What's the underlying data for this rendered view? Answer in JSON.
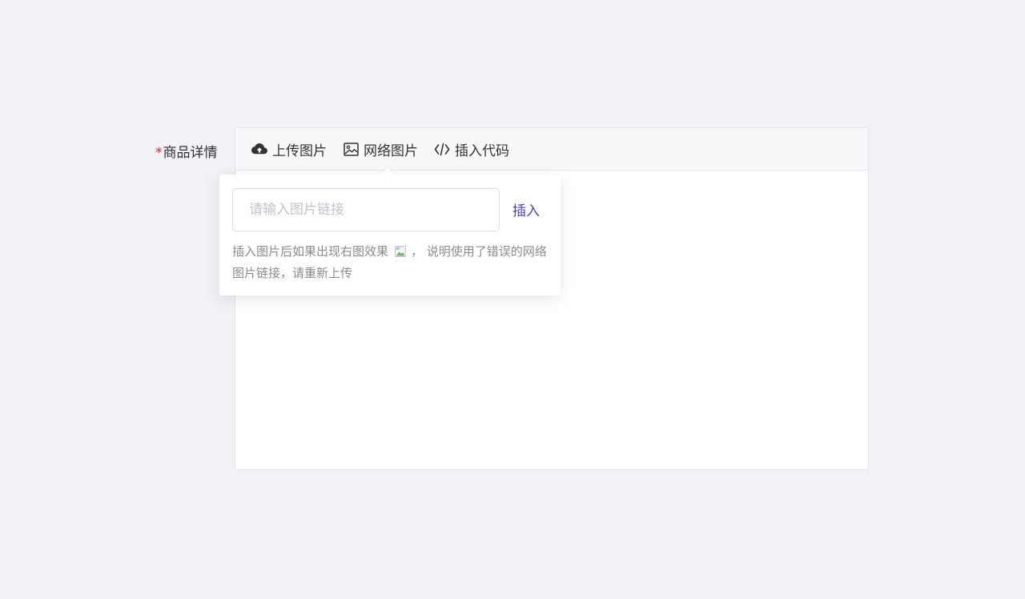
{
  "field": {
    "required_mark": "*",
    "label": "商品详情"
  },
  "toolbar": {
    "items": [
      {
        "label": "上传图片",
        "icon": "cloud-upload-icon"
      },
      {
        "label": "网络图片",
        "icon": "image-icon"
      },
      {
        "label": "插入代码",
        "icon": "code-icon"
      }
    ]
  },
  "popover": {
    "placeholder": "请输入图片链接",
    "insert_label": "插入",
    "hint_before": "插入图片后如果出现右图效果",
    "hint_after": "，  说明使用了错误的网络图片链接，请重新上传"
  },
  "colors": {
    "accent": "#4b3fc9",
    "required": "#f5222d",
    "background": "#f0f2f5"
  }
}
